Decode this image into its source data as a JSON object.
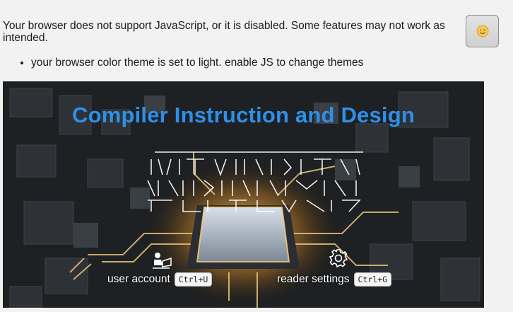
{
  "noscript": {
    "message": "Your browser does not support JavaScript, or it is disabled. Some features may not work as intended.",
    "theme_items": [
      "your browser color theme is set to light. enable JS to change themes"
    ]
  },
  "theme_toggle": {
    "icon": "sun-face-icon"
  },
  "banner": {
    "title": "Compiler Instruction and Design",
    "title_color": "#2f8fe8",
    "logo_icon": "ascii-art-logo"
  },
  "nav": {
    "user_account": {
      "label": "user account",
      "shortcut": "Ctrl+U",
      "icon": "user-reading-icon"
    },
    "reader_settings": {
      "label": "reader settings",
      "shortcut": "Ctrl+G",
      "icon": "gear-icon"
    }
  }
}
